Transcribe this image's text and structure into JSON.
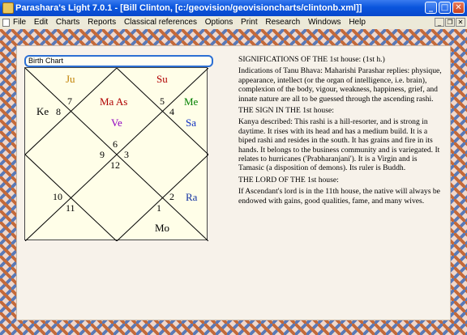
{
  "window": {
    "title": "Parashara's Light 7.0.1 - [Bill Clinton,  [c:/geovision/geovisioncharts/clintonb.xml]]"
  },
  "menu": [
    "File",
    "Edit",
    "Charts",
    "Reports",
    "Classical references",
    "Options",
    "Print",
    "Research",
    "Windows",
    "Help"
  ],
  "chart": {
    "label": "Birth Chart",
    "house_numbers": [
      "7",
      "8",
      "5",
      "4",
      "6",
      "9",
      "3",
      "12",
      "2",
      "10",
      "11",
      "1"
    ],
    "planets": {
      "ju": "Ju",
      "su": "Su",
      "ke": "Ke",
      "ma_as": "Ma As",
      "me": "Me",
      "ve": "Ve",
      "sa": "Sa",
      "ra": "Ra",
      "mo": "Mo"
    },
    "colors": {
      "ju": "#c08000",
      "su": "#b00000",
      "ke": "#000000",
      "ma_as": "#b00000",
      "me": "#008000",
      "ve": "#9000c0",
      "sa": "#1030c0",
      "ra": "#1030a0",
      "mo": "#000000"
    }
  },
  "text": {
    "p1": "SIGNIFICATIONS OF THE 1st house: (1st h.)",
    "p2": "Indications of Tanu Bhava: Maharishi Parashar replies: physique, appearance, intellect (or the organ of intelligence, i.e. brain), complexion of the body, vigour, weakness, happiness, grief, and innate nature are all to be guessed through the ascending rashi.",
    "p3": "THE SIGN IN THE 1st house:",
    "p4": "Kanya described: This rashi is a hill-resorter, and  is strong in daytime. It rises with its head and has a  medium build. It is a biped rashi and resides in the south.  It  has grains and fire in its hands.  It belongs to the  business community and is variegated. It relates to  hurricanes ('Prabharanjani'). It is a Virgin and is Tamasic  (a disposition of demons). Its ruler is Buddh.",
    "p5": "THE LORD OF THE 1st house:",
    "p6": "If Ascendant's lord is in the 11th house, the native will always be endowed with gains, good qualities, fame, and many wives."
  }
}
